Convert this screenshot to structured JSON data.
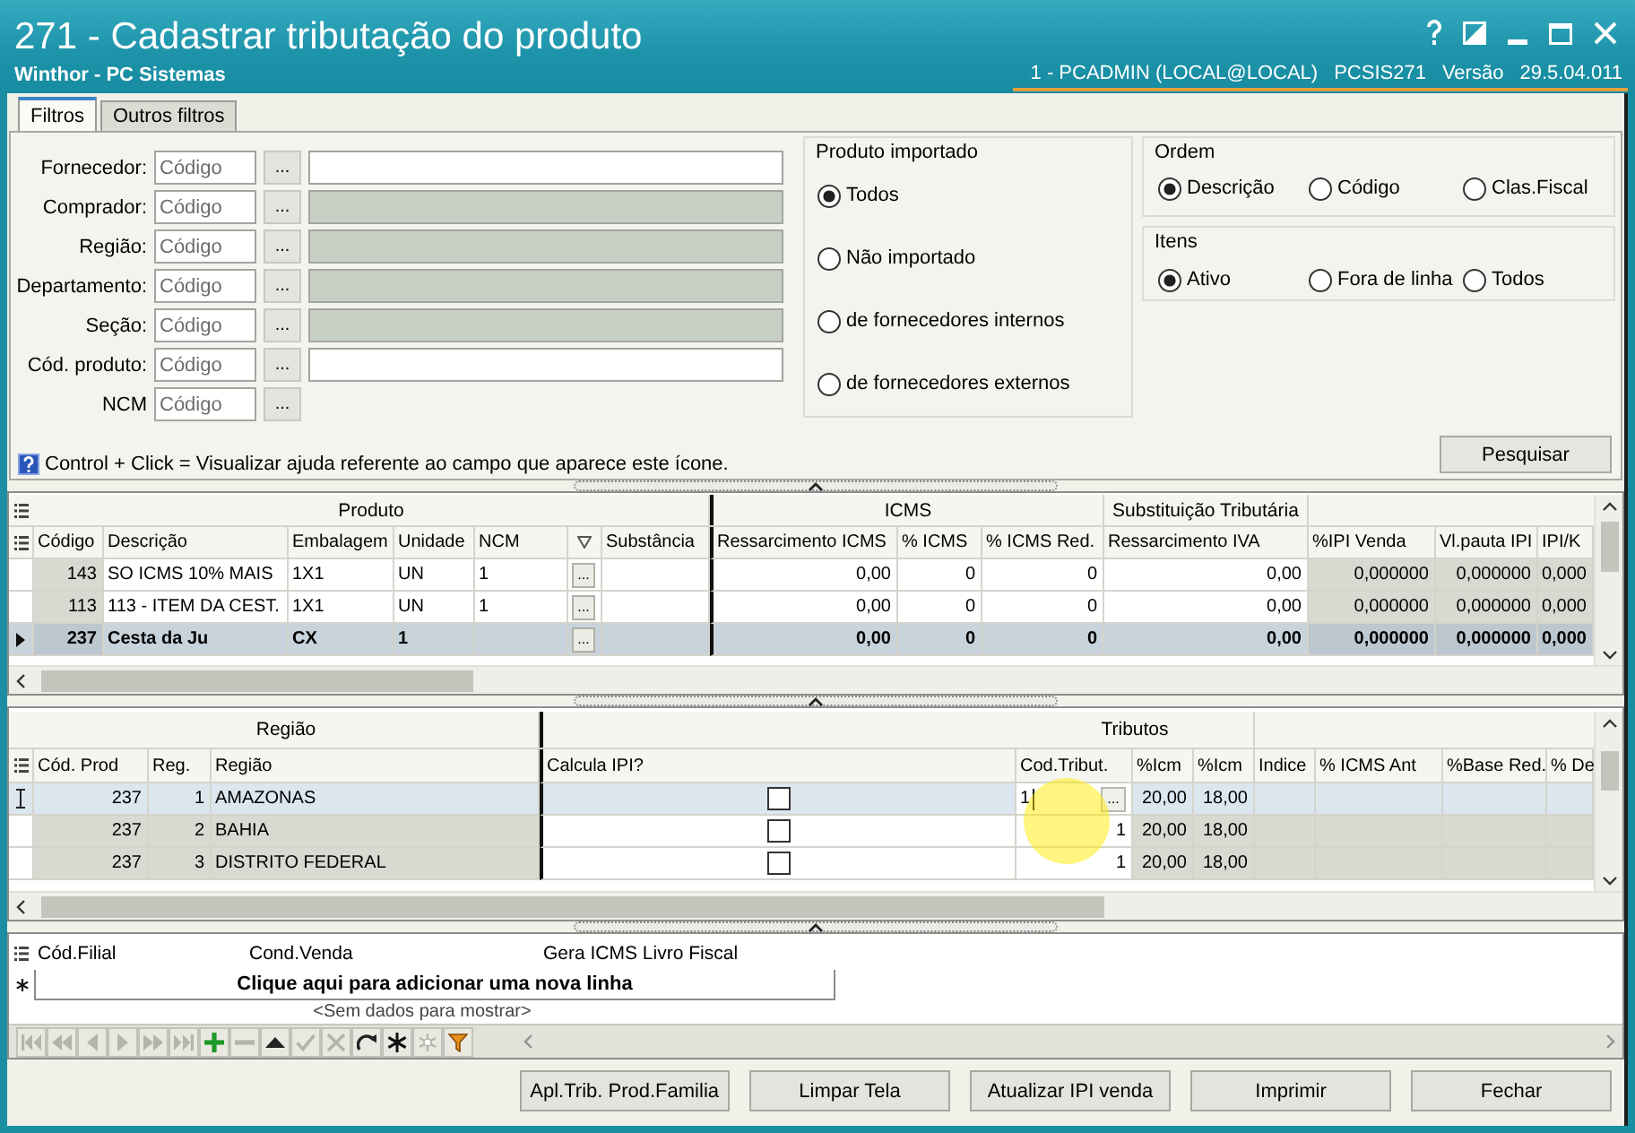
{
  "window": {
    "title": "271 - Cadastrar tributação do produto",
    "subtitle": "Winthor - PC Sistemas",
    "session": "1 - PCADMIN (LOCAL@LOCAL)",
    "program": "PCSIS271",
    "version_label": "Versão",
    "version": "29.5.04.011"
  },
  "tabs": [
    {
      "label": "Filtros",
      "selected": true
    },
    {
      "label": "Outros filtros",
      "selected": false
    }
  ],
  "filters": [
    {
      "label": "Fornecedor:",
      "placeholder": "Código",
      "lookup": "...",
      "name_field": {
        "disabled": false
      }
    },
    {
      "label": "Comprador:",
      "placeholder": "Código",
      "lookup": "...",
      "name_field": {
        "disabled": true
      }
    },
    {
      "label": "Região:",
      "placeholder": "Código",
      "lookup": "...",
      "name_field": {
        "disabled": true
      }
    },
    {
      "label": "Departamento:",
      "placeholder": "Código",
      "lookup": "...",
      "name_field": {
        "disabled": true
      }
    },
    {
      "label": "Seção:",
      "placeholder": "Código",
      "lookup": "...",
      "name_field": {
        "disabled": true
      }
    },
    {
      "label": "Cód. produto:",
      "placeholder": "Código",
      "lookup": "...",
      "name_field": {
        "disabled": false
      }
    },
    {
      "label": "NCM",
      "placeholder": "Código",
      "lookup": "..."
    }
  ],
  "help_hint": "Control + Click = Visualizar ajuda referente ao campo que aparece este ícone.",
  "import_filter": {
    "title": "Produto importado",
    "options": [
      {
        "label": "Todos",
        "selected": true
      },
      {
        "label": "Não importado",
        "selected": false
      },
      {
        "label": "de fornecedores internos",
        "selected": false
      },
      {
        "label": "de fornecedores externos",
        "selected": false
      }
    ]
  },
  "order": {
    "title": "Ordem",
    "options": [
      {
        "label": "Descrição",
        "selected": true
      },
      {
        "label": "Código",
        "selected": false
      },
      {
        "label": "Clas.Fiscal",
        "selected": false
      }
    ]
  },
  "items_filter": {
    "title": "Itens",
    "options": [
      {
        "label": "Ativo",
        "selected": true
      },
      {
        "label": "Fora de linha",
        "selected": false
      },
      {
        "label": "Todos",
        "selected": false
      }
    ]
  },
  "search_button": "Pesquisar",
  "product_grid": {
    "bands": [
      {
        "label": "Produto",
        "columns": [
          {
            "label": "Código",
            "kind": "number",
            "read_only": true
          },
          {
            "label": "Descrição",
            "kind": "text"
          },
          {
            "label": "Embalagem",
            "kind": "text"
          },
          {
            "label": "Unidade",
            "kind": "text"
          },
          {
            "label": "NCM",
            "kind": "text"
          },
          {
            "kind": "lookup"
          },
          {
            "label": "Substância",
            "kind": "text"
          }
        ]
      },
      {
        "label": "ICMS",
        "columns": [
          {
            "label": "Ressarcimento ICMS",
            "kind": "number"
          },
          {
            "label": "% ICMS",
            "kind": "number"
          },
          {
            "label": "% ICMS Red.",
            "kind": "number"
          }
        ]
      },
      {
        "label": "Substituição Tributária",
        "columns": [
          {
            "label": "Ressarcimento IVA",
            "kind": "number"
          }
        ]
      },
      {
        "columns": [
          {
            "label": "%IPI Venda",
            "kind": "number",
            "read_only": true
          },
          {
            "label": "Vl.pauta IPI",
            "kind": "number",
            "read_only": true
          },
          {
            "label": "IPI/K",
            "kind": "number",
            "read_only": true
          }
        ]
      }
    ],
    "rows": [
      {
        "selected": false,
        "cells": [
          "143",
          "SO ICMS 10% MAIS",
          "1X1",
          "UN",
          "1",
          "...",
          null,
          "0,00",
          "0",
          "0",
          "0,00",
          "0,000000",
          "0,000000",
          "0,000"
        ]
      },
      {
        "selected": false,
        "cells": [
          "113",
          "113 - ITEM DA CEST.",
          "1X1",
          "UN",
          "1",
          "...",
          null,
          "0,00",
          "0",
          "0",
          "0,00",
          "0,000000",
          "0,000000",
          "0,000"
        ]
      },
      {
        "selected": true,
        "cells": [
          "237",
          "Cesta da Ju",
          "CX",
          "1",
          null,
          "...",
          null,
          "0,00",
          "0",
          "0",
          "0,00",
          "0,000000",
          "0,000000",
          "0,000"
        ]
      }
    ]
  },
  "region_grid": {
    "editor_button": "...",
    "bands": [
      {
        "label": "Região",
        "columns": [
          {
            "label": "Cód. Prod",
            "kind": "number",
            "read_only": true
          },
          {
            "label": "Reg.",
            "kind": "number",
            "read_only": true
          },
          {
            "label": "Região",
            "kind": "text",
            "read_only": true
          }
        ]
      },
      {
        "columns": [
          {
            "label": "Calcula IPI?",
            "kind": "check"
          }
        ]
      },
      {
        "label": "Tributos",
        "columns": [
          {
            "label": "Cod.Tribut.",
            "kind": "code"
          },
          {
            "label": "%Icm",
            "kind": "number",
            "read_only": true
          },
          {
            "label": "%Icm",
            "kind": "number",
            "read_only": true
          }
        ]
      },
      {
        "columns": [
          {
            "label": "Indice",
            "kind": "number",
            "read_only": true
          },
          {
            "label": "% ICMS Ant",
            "kind": "number",
            "read_only": true
          },
          {
            "label": "%Base Red.",
            "kind": "number",
            "read_only": true
          },
          {
            "label": "% De",
            "kind": "number",
            "read_only": true
          }
        ]
      }
    ],
    "rows": [
      {
        "selected": true,
        "editing": true,
        "cells": [
          "237",
          "1",
          "AMAZONAS",
          false,
          "1",
          "20,00",
          "18,00"
        ]
      },
      {
        "selected": false,
        "editing": false,
        "cells": [
          "237",
          "2",
          "BAHIA",
          false,
          "1",
          "20,00",
          "18,00"
        ]
      },
      {
        "selected": false,
        "editing": false,
        "cells": [
          "237",
          "3",
          "DISTRITO FEDERAL",
          false,
          "1",
          "20,00",
          "18,00"
        ]
      }
    ]
  },
  "branch_grid": {
    "columns": [
      "Cód.Filial",
      "Cond.Venda",
      "Gera ICMS Livro Fiscal"
    ],
    "new_row_prompt": "Clique aqui para adicionar uma nova linha",
    "empty_text": "<Sem dados para mostrar>"
  },
  "navigator": [
    {
      "kind": "first",
      "disabled": true
    },
    {
      "kind": "prev_page",
      "disabled": true
    },
    {
      "kind": "prev",
      "disabled": true
    },
    {
      "kind": "next",
      "disabled": true
    },
    {
      "kind": "next_page",
      "disabled": true
    },
    {
      "kind": "last",
      "disabled": true
    },
    {
      "kind": "add",
      "disabled": false
    },
    {
      "kind": "remove",
      "disabled": true
    },
    {
      "kind": "up",
      "disabled": false
    },
    {
      "kind": "confirm",
      "disabled": true
    },
    {
      "kind": "cancel",
      "disabled": true
    },
    {
      "kind": "refresh",
      "disabled": false
    },
    {
      "kind": "insert",
      "disabled": false
    },
    {
      "kind": "clear",
      "disabled": true
    },
    {
      "kind": "filter",
      "disabled": false
    }
  ],
  "buttons": [
    "Apl.Trib. Prod.Familia",
    "Limpar Tela",
    "Atualizar IPI venda",
    "Imprimir",
    "Fechar"
  ]
}
